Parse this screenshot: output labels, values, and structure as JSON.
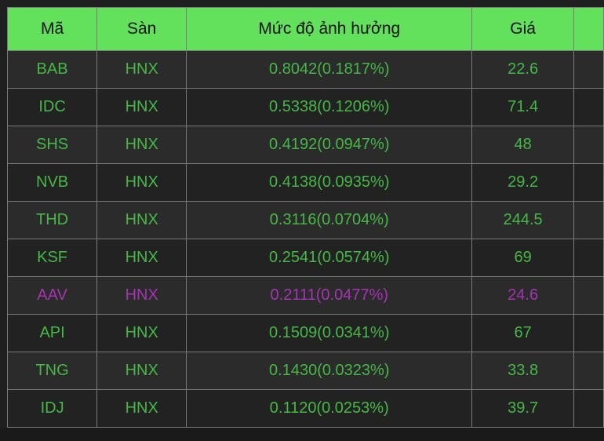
{
  "colors": {
    "header_bg": "#63e05c",
    "up": "#45b845",
    "reference": "#a633b3",
    "row_odd": "#2b2b2b",
    "row_even": "#222222"
  },
  "table": {
    "headers": [
      "Mã",
      "Sàn",
      "Mức độ ảnh hưởng",
      "Giá",
      ""
    ],
    "rows": [
      {
        "ma": "BAB",
        "san": "HNX",
        "muc": "0.8042(0.1817%)",
        "gia": "22.6",
        "status": "up"
      },
      {
        "ma": "IDC",
        "san": "HNX",
        "muc": "0.5338(0.1206%)",
        "gia": "71.4",
        "status": "up"
      },
      {
        "ma": "SHS",
        "san": "HNX",
        "muc": "0.4192(0.0947%)",
        "gia": "48",
        "status": "up"
      },
      {
        "ma": "NVB",
        "san": "HNX",
        "muc": "0.4138(0.0935%)",
        "gia": "29.2",
        "status": "up"
      },
      {
        "ma": "THD",
        "san": "HNX",
        "muc": "0.3116(0.0704%)",
        "gia": "244.5",
        "status": "up"
      },
      {
        "ma": "KSF",
        "san": "HNX",
        "muc": "0.2541(0.0574%)",
        "gia": "69",
        "status": "up"
      },
      {
        "ma": "AAV",
        "san": "HNX",
        "muc": "0.2111(0.0477%)",
        "gia": "24.6",
        "status": "reference"
      },
      {
        "ma": "API",
        "san": "HNX",
        "muc": "0.1509(0.0341%)",
        "gia": "67",
        "status": "up"
      },
      {
        "ma": "TNG",
        "san": "HNX",
        "muc": "0.1430(0.0323%)",
        "gia": "33.8",
        "status": "up"
      },
      {
        "ma": "IDJ",
        "san": "HNX",
        "muc": "0.1120(0.0253%)",
        "gia": "39.7",
        "status": "up"
      }
    ]
  }
}
